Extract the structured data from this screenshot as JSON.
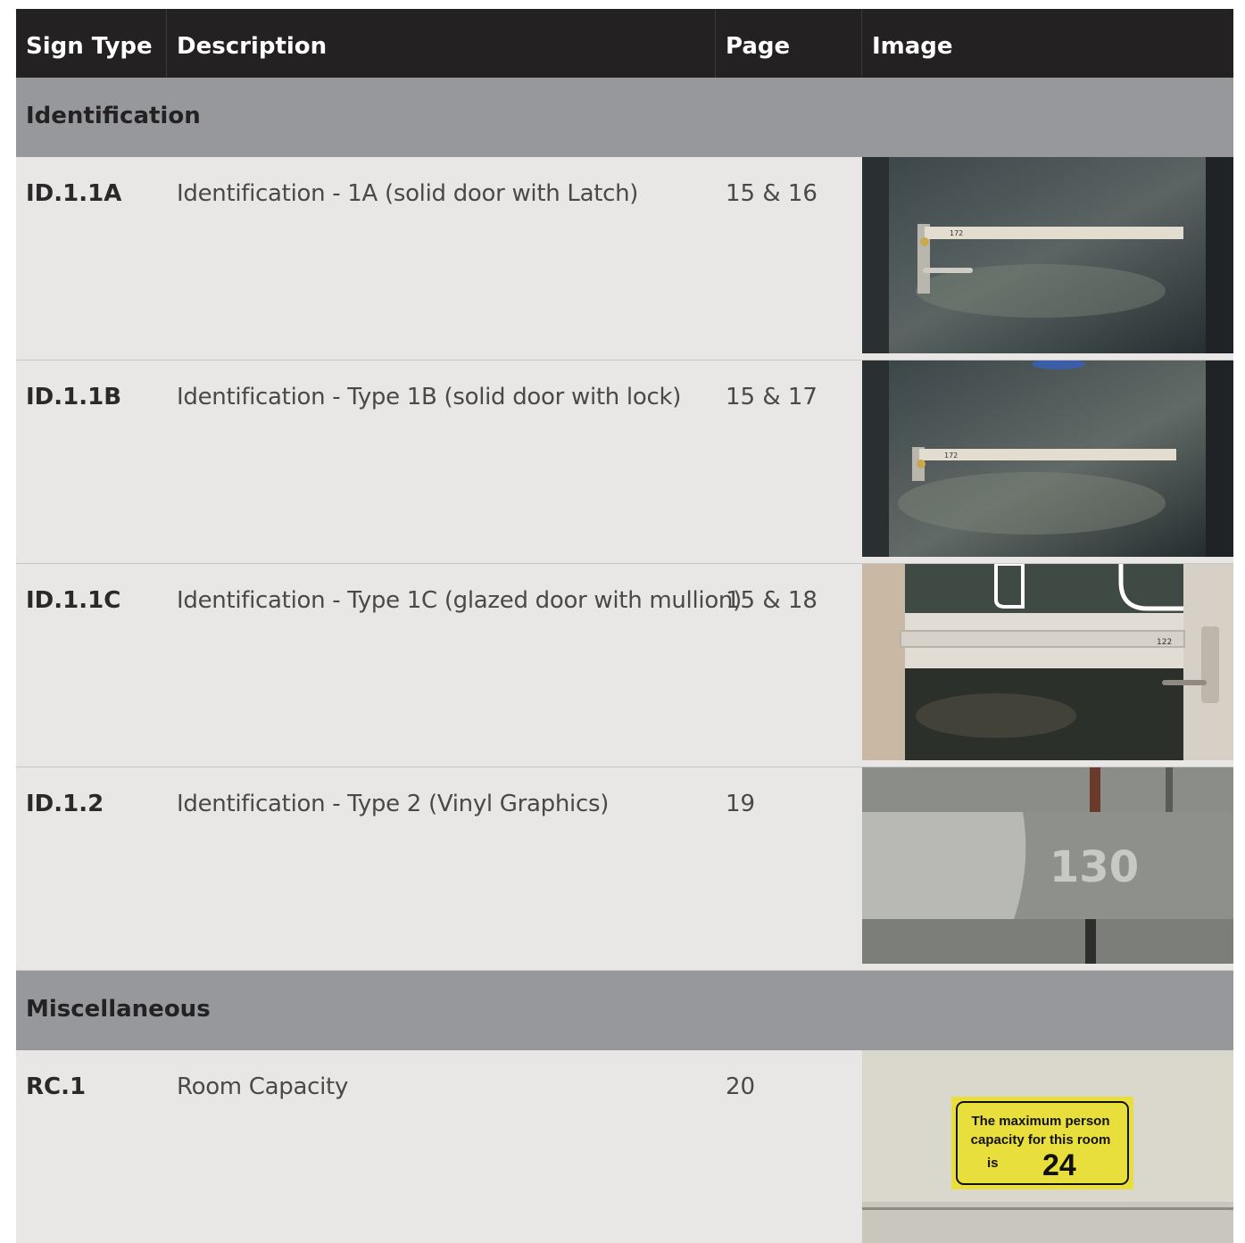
{
  "header": {
    "sign_type": "Sign Type",
    "description": "Description",
    "page": "Page",
    "image": "Image"
  },
  "sections": [
    {
      "title": "Identification",
      "rows": [
        {
          "code": "ID.1.1A",
          "description": "Identification - 1A (solid door with Latch)",
          "page": "15 & 16",
          "image_label": "172"
        },
        {
          "code": "ID.1.1B",
          "description": "Identification - Type 1B (solid door with lock)",
          "page": "15 & 17",
          "image_label": "172"
        },
        {
          "code": "ID.1.1C",
          "description": "Identification - Type 1C (glazed door with mullion)",
          "page": "15 & 18",
          "image_label": "122"
        },
        {
          "code": "ID.1.2",
          "description": "Identification - Type 2 (Vinyl Graphics)",
          "page": "19",
          "image_label": "130"
        }
      ]
    },
    {
      "title": "Miscellaneous",
      "rows": [
        {
          "code": "RC.1",
          "description": "Room Capacity",
          "page": "20",
          "image_sign": {
            "line1": "The maximum person",
            "line2": "capacity for this room",
            "line3": "is",
            "number": "24"
          }
        }
      ]
    }
  ]
}
